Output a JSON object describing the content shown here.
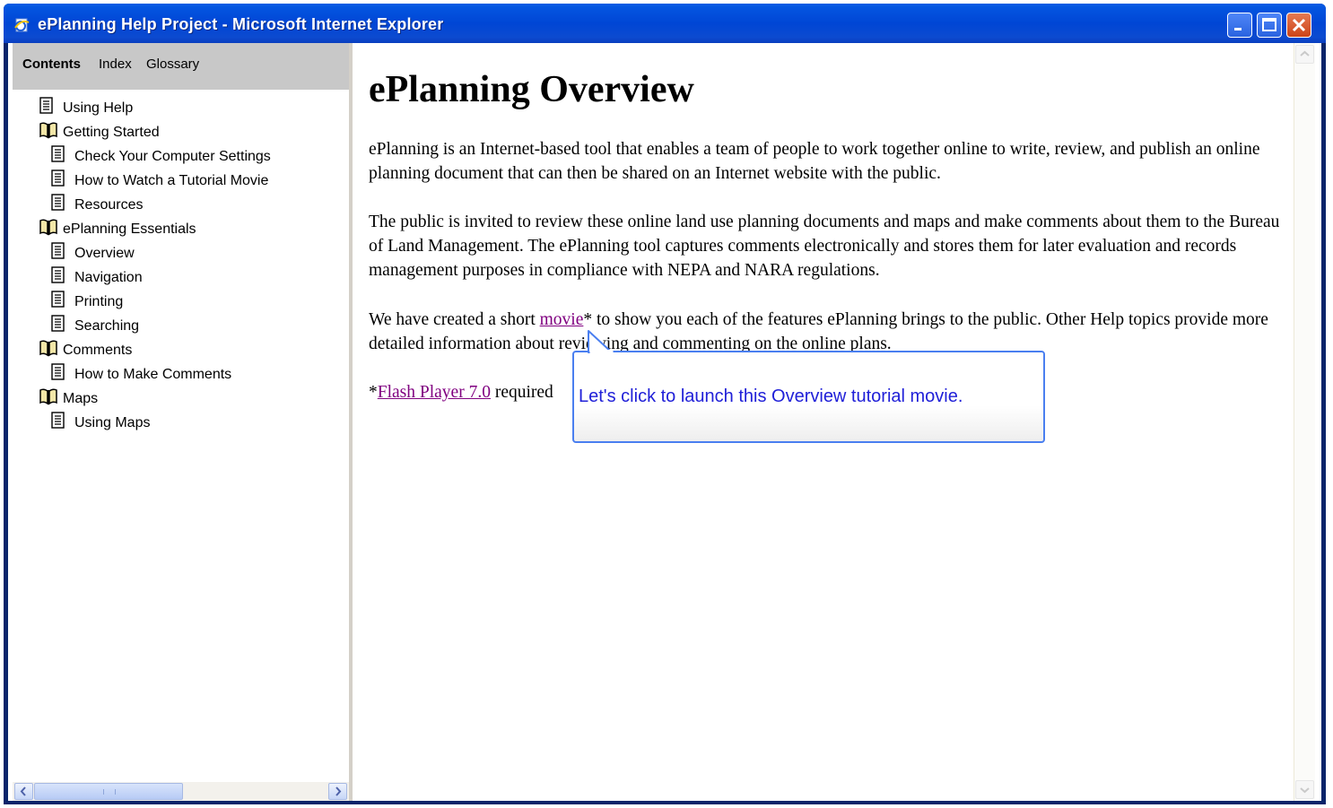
{
  "window": {
    "title": "ePlanning Help Project - Microsoft Internet Explorer",
    "accent_color": "#0046d5",
    "controls": [
      "minimize-icon",
      "maximize-icon",
      "close-icon"
    ]
  },
  "nav": {
    "tabs": [
      {
        "label": "Contents",
        "active": true
      },
      {
        "label": "Index",
        "active": false
      },
      {
        "label": "Glossary",
        "active": false
      }
    ],
    "toc": [
      {
        "label": "Using Help",
        "icon": "page-icon",
        "level": 0
      },
      {
        "label": "Getting Started",
        "icon": "book-icon",
        "level": 0
      },
      {
        "label": "Check Your Computer Settings",
        "icon": "page-icon",
        "level": 1
      },
      {
        "label": "How to Watch a Tutorial Movie",
        "icon": "page-icon",
        "level": 1
      },
      {
        "label": "Resources",
        "icon": "page-icon",
        "level": 1
      },
      {
        "label": "ePlanning Essentials",
        "icon": "book-icon",
        "level": 0
      },
      {
        "label": "Overview",
        "icon": "page-icon",
        "level": 1
      },
      {
        "label": "Navigation",
        "icon": "page-icon",
        "level": 1
      },
      {
        "label": "Printing",
        "icon": "page-icon",
        "level": 1
      },
      {
        "label": "Searching",
        "icon": "page-icon",
        "level": 1
      },
      {
        "label": "Comments",
        "icon": "book-icon",
        "level": 0
      },
      {
        "label": "How to Make Comments",
        "icon": "page-icon",
        "level": 1
      },
      {
        "label": "Maps",
        "icon": "book-icon",
        "level": 0
      },
      {
        "label": "Using Maps",
        "icon": "page-icon",
        "level": 1
      }
    ]
  },
  "content": {
    "heading": "ePlanning Overview",
    "p1": "ePlanning is an Internet-based tool that enables a team of people to work together online to write, review, and publish an online planning document that can then be shared on an Internet website with the public.",
    "p2": "The public is invited to review these online land use planning documents and maps and make comments about them to the Bureau of Land Management.  The ePlanning tool captures comments electronically and stores them for later evaluation and records management purposes in compliance with NEPA and NARA regulations.",
    "p3_before": "We have created a short ",
    "p3_link": "movie",
    "p3_after": "* to show you each of the features ePlanning brings to the public. Other Help topics provide more detailed information about reviewing and commenting on the online plans.",
    "p4_prefix": "*",
    "p4_link": "Flash Player 7.0",
    "p4_after": " required",
    "link_color": "#800080"
  },
  "callout": {
    "text": "Let's click to launch this Overview tutorial movie.",
    "border_color": "#4a7ff0",
    "text_color": "#2020d8"
  }
}
